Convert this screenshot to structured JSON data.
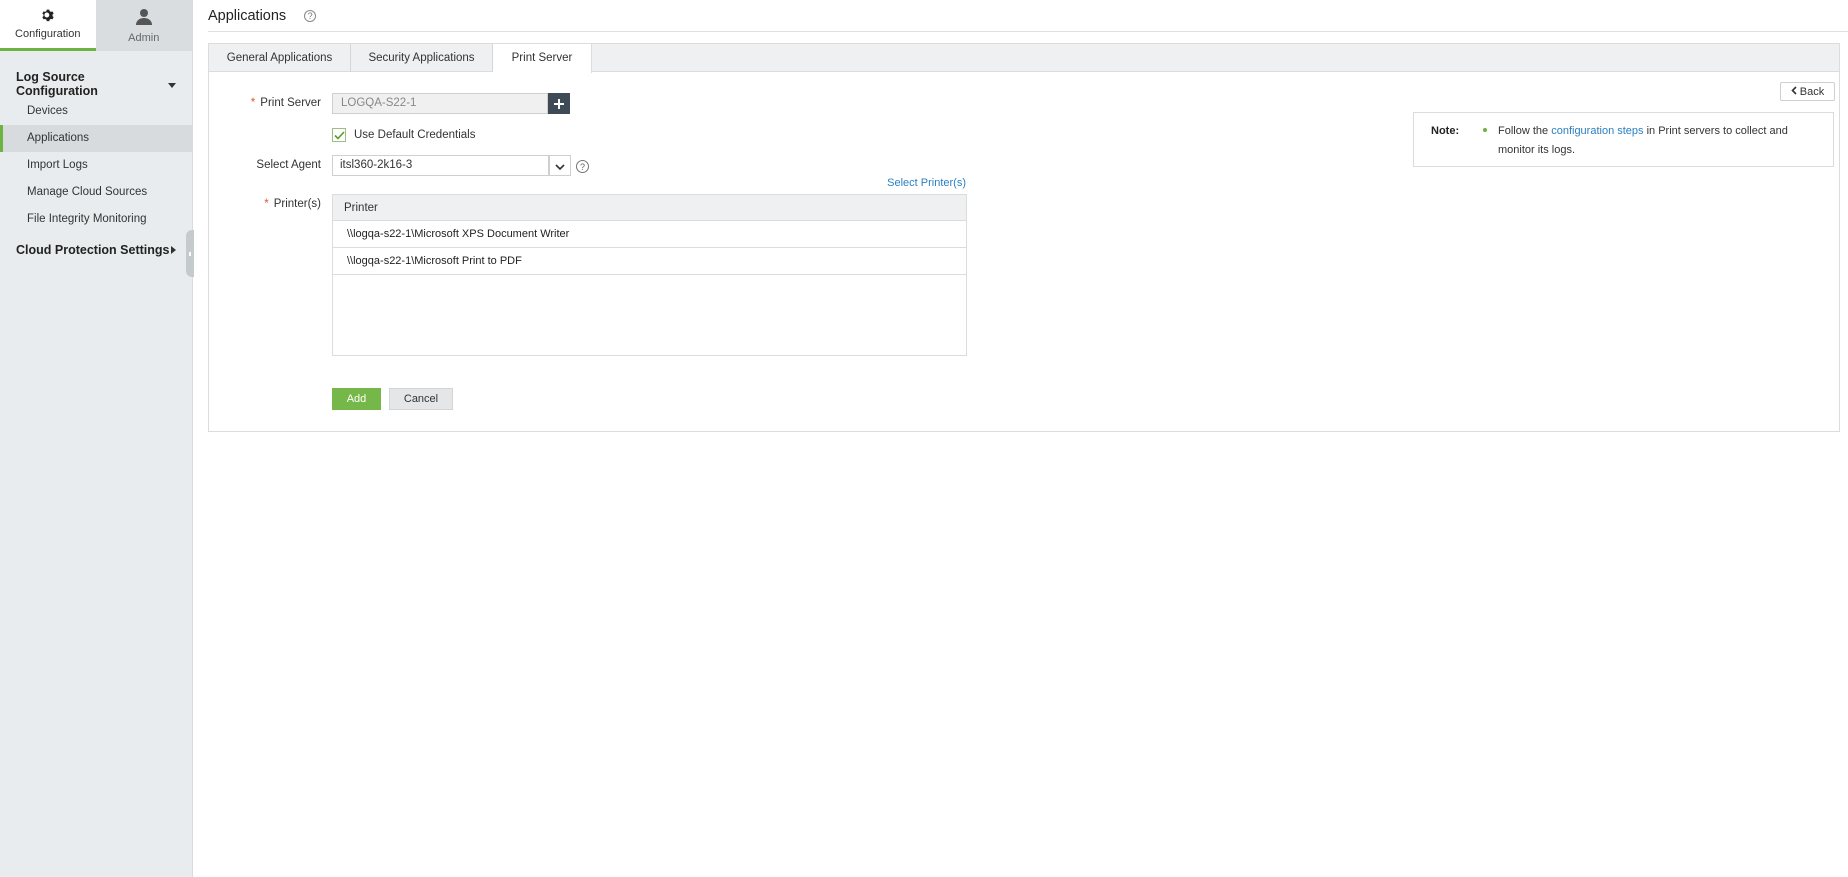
{
  "sidebar": {
    "top_tabs": [
      {
        "label": "Configuration",
        "icon": "gear-icon"
      },
      {
        "label": "Admin",
        "icon": "user-icon"
      }
    ],
    "sections": [
      {
        "label": "Log Source Configuration",
        "expanded": true
      },
      {
        "label": "Cloud Protection Settings",
        "expanded": false
      }
    ],
    "items": [
      {
        "label": "Devices"
      },
      {
        "label": "Applications"
      },
      {
        "label": "Import Logs"
      },
      {
        "label": "Manage Cloud Sources"
      },
      {
        "label": "File Integrity Monitoring"
      }
    ],
    "active_item": "Applications"
  },
  "header": {
    "title": "Applications"
  },
  "tabs": [
    {
      "label": "General Applications"
    },
    {
      "label": "Security Applications"
    },
    {
      "label": "Print Server"
    }
  ],
  "form": {
    "print_server_label": "Print Server",
    "print_server_value": "LOGQA-S22-1",
    "use_default_credentials_label": "Use Default Credentials",
    "use_default_credentials_checked": true,
    "select_agent_label": "Select Agent",
    "select_agent_value": "itsl360-2k16-3",
    "select_printers_link": "Select Printer(s)",
    "printers_label": "Printer(s)",
    "printers_table": {
      "header": "Printer",
      "rows": [
        "\\\\logqa-s22-1\\Microsoft XPS Document Writer",
        "\\\\logqa-s22-1\\Microsoft Print to PDF"
      ]
    },
    "add_label": "Add",
    "cancel_label": "Cancel",
    "required_marker": "*"
  },
  "back_label": "Back",
  "note": {
    "label": "Note:",
    "text_before": "Follow the ",
    "link": "configuration steps",
    "text_after": " in Print servers to collect and monitor its logs."
  },
  "colors": {
    "accent_green": "#6cb33f",
    "link_blue": "#2a7fc1",
    "required_orange": "#e0582a",
    "dark_button": "#3e4a55"
  }
}
